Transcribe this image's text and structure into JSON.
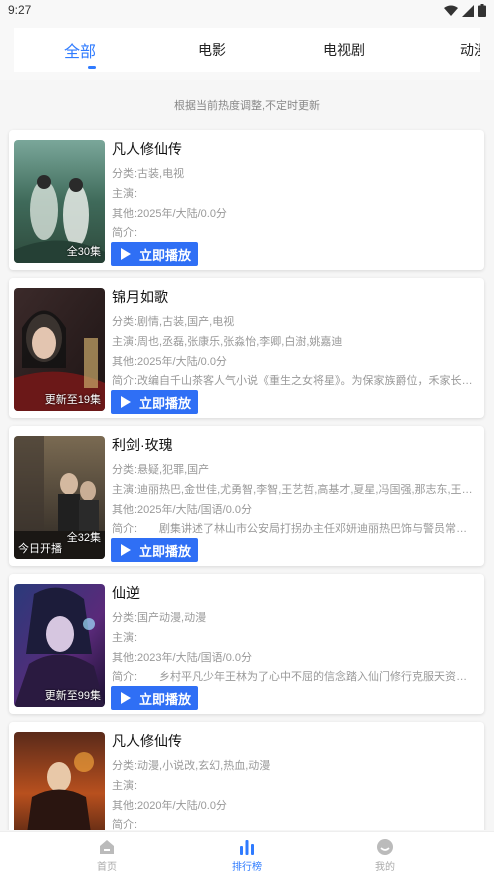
{
  "status": {
    "time": "9:27"
  },
  "tabs": [
    {
      "label": "全部"
    },
    {
      "label": "电影"
    },
    {
      "label": "电视剧"
    },
    {
      "label": "动漫"
    }
  ],
  "notice": "根据当前热度调整,不定时更新",
  "play_label": "立即播放",
  "items": [
    {
      "title": "凡人修仙传",
      "category": "分类:古装,电视",
      "cast": "主演:",
      "other": "其他:2025年/大陆/0.0分",
      "intro": "简介:",
      "episodes": "全30集",
      "sub_badge": ""
    },
    {
      "title": "锦月如歌",
      "category": "分类:剧情,古装,国产,电视",
      "cast": "主演:周也,丞磊,张康乐,张淼怡,李卿,白澍,姚嘉迪",
      "other": "其他:2025年/大陆/0.0分",
      "intro": "简介:改编自千山茶客人气小说《重生之女将星》。为保家族爵位，禾家长女...",
      "episodes": "更新至19集",
      "sub_badge": ""
    },
    {
      "title": "利剑·玫瑰",
      "category": "分类:悬疑,犯罪,国产",
      "cast": "主演:迪丽热巴,金世佳,尤勇智,李智,王艺哲,高基才,夏星,冯国强,那志东,王大奇,...",
      "other": "其他:2025年/大陆/国语/0.0分",
      "intro": "简介:　　剧集讲述了林山市公安局打拐办主任邓妍迪丽热巴饰与警员常锐金...",
      "episodes": "全32集",
      "sub_badge": "今日开播"
    },
    {
      "title": "仙逆",
      "category": "分类:国产动漫,动漫",
      "cast": "主演:",
      "other": "其他:2023年/大陆/国语/0.0分",
      "intro": "简介:　　乡村平凡少年王林为了心中不屈的信念踏入仙门修行克服天资不足...",
      "episodes": "更新至99集",
      "sub_badge": ""
    },
    {
      "title": "凡人修仙传",
      "category": "分类:动漫,小说改,玄幻,热血,动漫",
      "cast": "主演:",
      "other": "其他:2020年/大陆/0.0分",
      "intro": "简介:",
      "episodes": "",
      "sub_badge": ""
    }
  ],
  "bottom_nav": [
    {
      "label": "首页"
    },
    {
      "label": "排行榜"
    },
    {
      "label": "我的"
    }
  ],
  "colors": {
    "accent": "#2f7bff",
    "button": "#2f6ff5"
  }
}
